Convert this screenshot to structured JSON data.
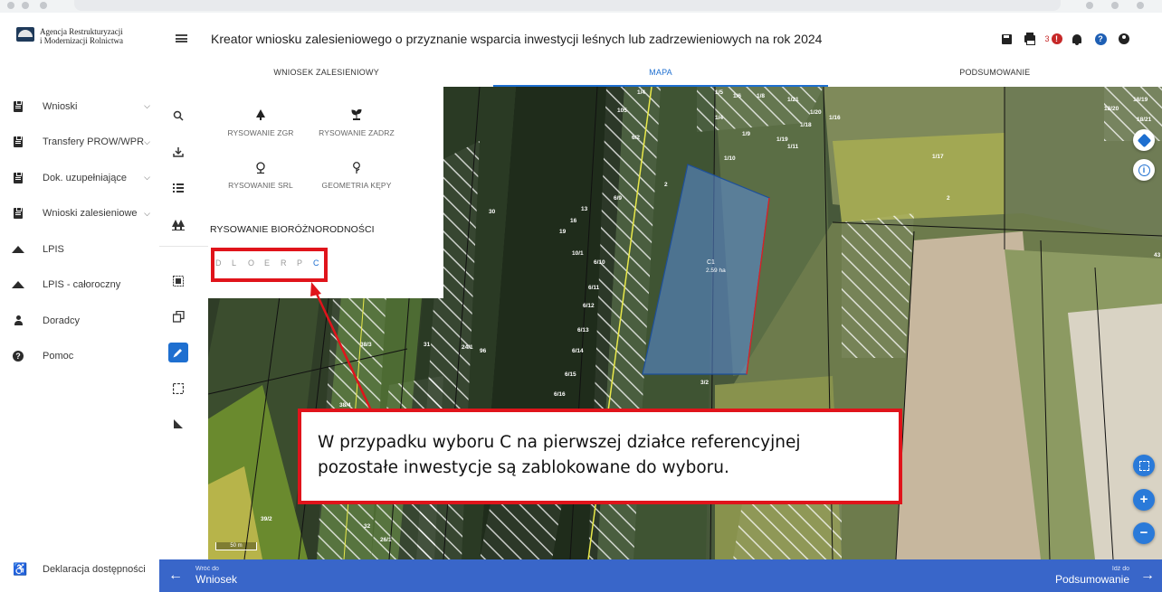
{
  "app": {
    "logo_line1": "Agencja Restrukturyzacji",
    "logo_line2": "i Modernizacji Rolnictwa",
    "title": "Kreator wniosku zalesieniowego o przyznanie wsparcia inwestycji leśnych lub zadrzewieniowych na rok 2024",
    "notification_count": "3"
  },
  "sidebar": {
    "items": [
      {
        "label": "Wnioski",
        "icon": "clipboard-icon",
        "expandable": true
      },
      {
        "label": "Transfery PROW/WPR",
        "icon": "clipboard-icon",
        "expandable": true
      },
      {
        "label": "Dok. uzupełniające",
        "icon": "clipboard-icon",
        "expandable": true
      },
      {
        "label": "Wnioski zalesieniowe",
        "icon": "clipboard-icon",
        "expandable": true
      },
      {
        "label": "LPIS",
        "icon": "mountain-icon",
        "expandable": false
      },
      {
        "label": "LPIS - całoroczny",
        "icon": "mountain-icon",
        "expandable": false
      },
      {
        "label": "Doradcy",
        "icon": "person-icon",
        "expandable": false
      },
      {
        "label": "Pomoc",
        "icon": "help-icon",
        "expandable": false
      }
    ],
    "accessibility": "Deklaracja dostępności"
  },
  "tabs": [
    {
      "label": "WNIOSEK ZALESIENIOWY",
      "active": false
    },
    {
      "label": "MAPA",
      "active": true
    },
    {
      "label": "PODSUMOWANIE",
      "active": false
    }
  ],
  "draw_panel": {
    "items": [
      {
        "label": "RYSOWANIE ZGR",
        "icon": "tree-icon"
      },
      {
        "label": "RYSOWANIE ZADRZ",
        "icon": "sapling-icon"
      },
      {
        "label": "RYSOWANIE SRL",
        "icon": "deciduous-tree-icon"
      },
      {
        "label": "GEOMETRIA KĘPY",
        "icon": "pin-tree-icon"
      }
    ],
    "biodiversity_title": "RYSOWANIE BIORÓŻNORODNOŚCI",
    "letters": [
      "D",
      "L",
      "O",
      "E",
      "R",
      "P",
      "C"
    ],
    "selected_letter": "C"
  },
  "map": {
    "parcel_label": "C1",
    "parcel_area": "2.59 ha",
    "scale": "50 m",
    "labels": [
      "105",
      "1/4",
      "1/5",
      "1/6",
      "1/8",
      "1/21",
      "1/20",
      "1/16",
      "1/9",
      "1/19",
      "1/18",
      "1/10",
      "1/11",
      "1/17",
      "2",
      "18/19",
      "18/20",
      "18/21",
      "6/2",
      "6/9",
      "13",
      "16",
      "19",
      "30",
      "10/1",
      "6/10",
      "6/11",
      "6/12",
      "6/13",
      "6/14",
      "6/15",
      "6/16",
      "2",
      "3/2",
      "38/3",
      "31",
      "24/1",
      "96",
      "38/4",
      "39/2",
      "32",
      "26/1",
      "43"
    ]
  },
  "callout": {
    "text": "W przypadku wyboru C na pierwszej działce referencyjnej pozostałe inwestycje są zablokowane do wyboru."
  },
  "bottom": {
    "back_small": "Wróć do",
    "back_label": "Wniosek",
    "next_small": "Idź do",
    "next_label": "Podsumowanie"
  },
  "colors": {
    "accent": "#1e6fd0",
    "highlight": "#e0141b",
    "bottom_bar": "#3966c9",
    "alert": "#c62828"
  }
}
